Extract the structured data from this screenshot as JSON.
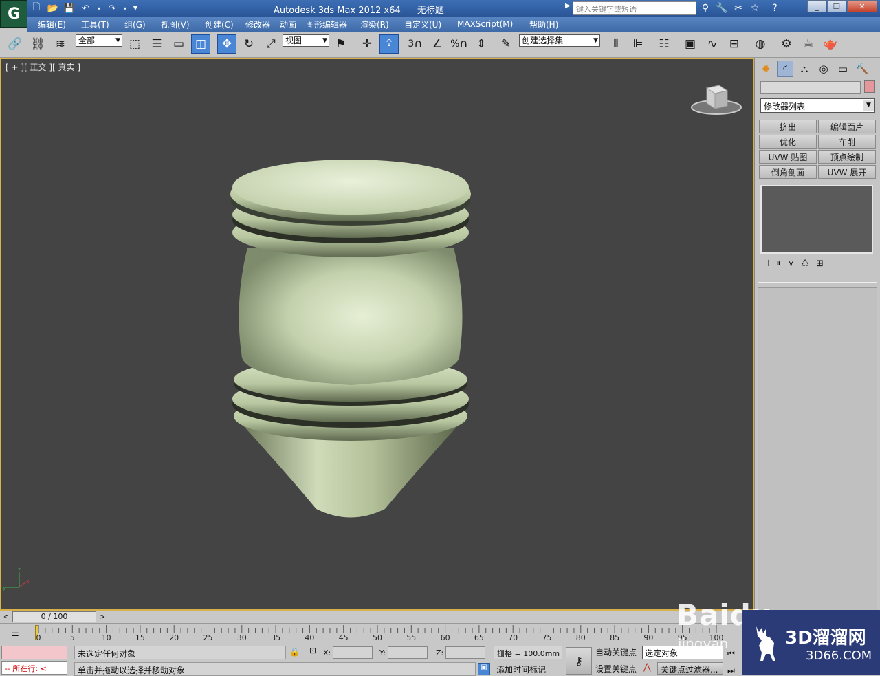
{
  "app": {
    "logo_glyph": "G",
    "title": "Autodesk 3ds Max  2012 x64",
    "document": "无标题",
    "search_placeholder": "键入关键字或短语",
    "help": "?"
  },
  "menu": [
    "编辑(E)",
    "工具(T)",
    "组(G)",
    "视图(V)",
    "创建(C)",
    "修改器",
    "动画",
    "图形编辑器",
    "渲染(R)",
    "自定义(U)",
    "MAXScript(M)",
    "帮助(H)"
  ],
  "toolbar": {
    "selection_filter": "全部",
    "ref_coord": "视图",
    "named_selection": "创建选择集",
    "snap_3": "3",
    "percent": "%"
  },
  "viewport": {
    "label": "[ + ][ 正交 ][ 真实 ]",
    "object_color": "#c4d1ad",
    "bg_color": "#444444",
    "border_color": "#d9b14a"
  },
  "command_panel": {
    "modifier_list": "修改器列表",
    "color_swatch": "#e5979b",
    "modifier_buttons": [
      "挤出",
      "编辑面片",
      "优化",
      "车削",
      "UVW 贴图",
      "顶点绘制",
      "倒角剖面",
      "UVW 展开"
    ]
  },
  "timeline": {
    "frame_display": "0 / 100",
    "current_frame": 0,
    "tick_labels": [
      "0",
      "5",
      "10",
      "15",
      "20",
      "25",
      "30",
      "35",
      "40",
      "45",
      "50",
      "55",
      "60",
      "65",
      "70",
      "75",
      "80",
      "85",
      "90",
      "95",
      "100"
    ]
  },
  "status": {
    "running_label": "--  所在行:  <",
    "selection_status": "未选定任何对象",
    "prompt": "单击并拖动以选择并移动对象",
    "x_label": "X:",
    "y_label": "Y:",
    "z_label": "Z:",
    "grid": "栅格 = 100.0mm",
    "add_time_tag": "添加时间标记",
    "auto_key": "自动关键点",
    "set_key": "设置关键点",
    "selected_set": "选定对象",
    "key_filters": "关键点过滤器..."
  },
  "watermarks": {
    "baidu_text": "Baidu",
    "baidu_sub": "jingyan",
    "site_cn": "3D溜溜网",
    "site_url": "3D66.COM"
  }
}
